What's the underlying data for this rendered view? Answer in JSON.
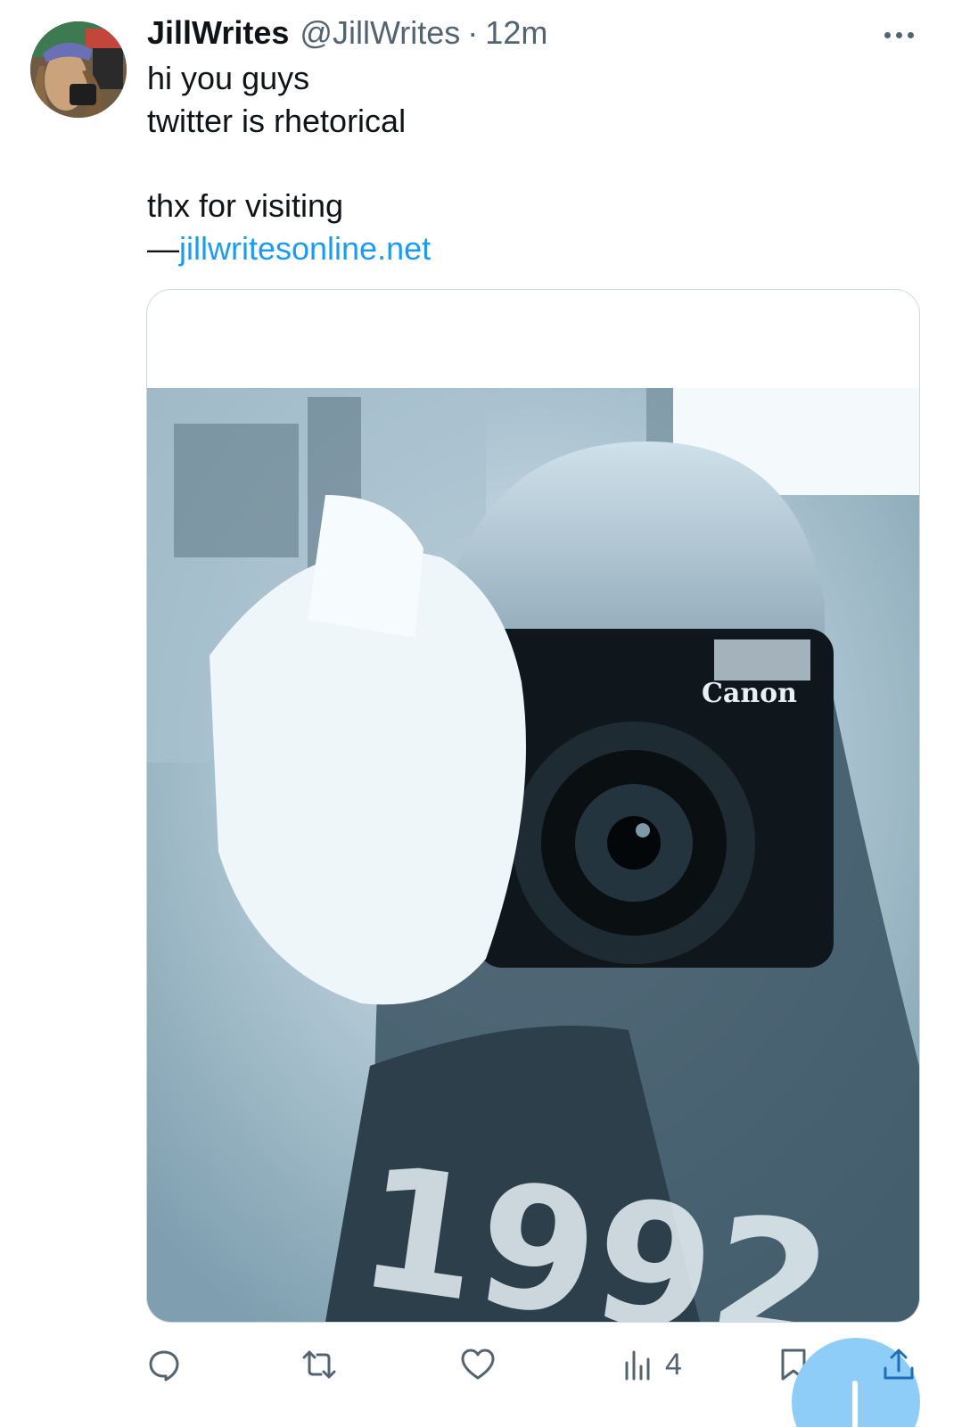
{
  "tweet": {
    "display_name": "JillWrites",
    "handle": "@JillWrites",
    "separator": "·",
    "time": "12m",
    "text_lines": [
      "hi you guys",
      "twitter is rhetorical",
      "",
      "thx for visiting"
    ],
    "attribution_dash": "—",
    "link_text": "jillwritesonline.net"
  },
  "actions": {
    "views_count": "4"
  },
  "icons": {
    "more": "more-horizontal-icon",
    "reply": "reply-icon",
    "retweet": "retweet-icon",
    "like": "heart-icon",
    "views": "analytics-icon",
    "bookmark": "bookmark-icon",
    "share": "share-icon"
  },
  "colors": {
    "link": "#1d9bf0",
    "secondary_text": "#536471",
    "fab": "#8ecdf8"
  }
}
